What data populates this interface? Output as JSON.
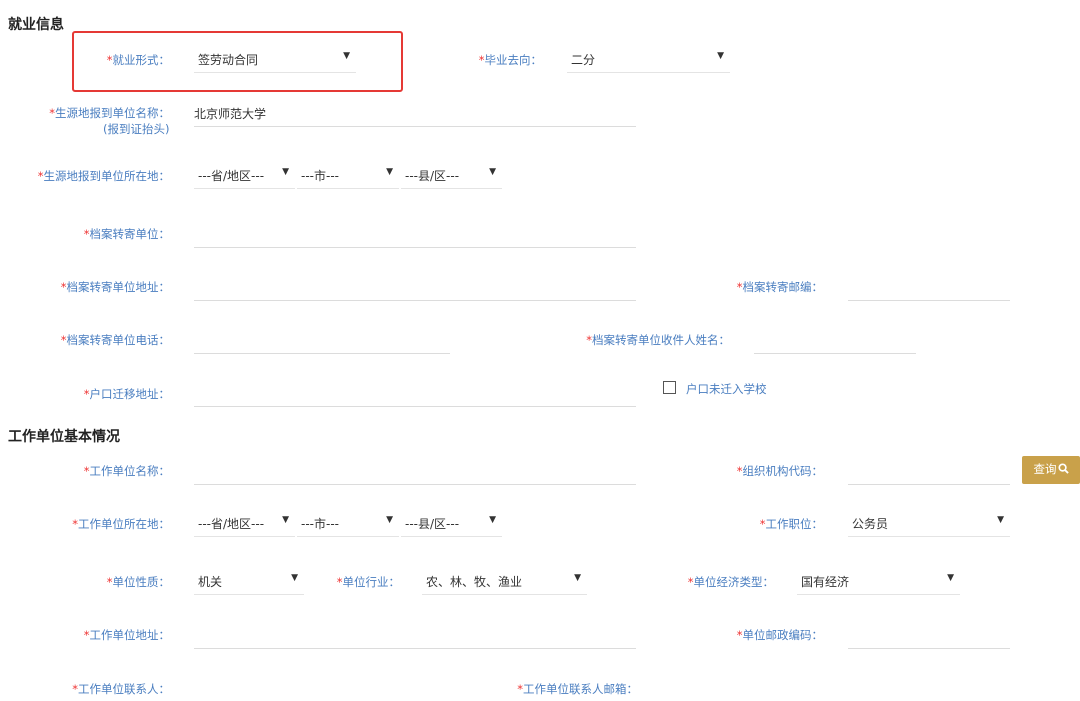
{
  "employment_info": {
    "title": "就业信息",
    "employment_form": {
      "label": "就业形式：",
      "value": "签劳动合同"
    },
    "graduation_destination": {
      "label": "毕业去向：",
      "value": "二分"
    },
    "report_unit_name": {
      "label": "生源地报到单位名称：",
      "sub_label": "(报到证抬头)",
      "value": "北京师范大学"
    },
    "report_unit_location": {
      "label": "生源地报到单位所在地：",
      "province": "---省/地区---",
      "city": "---市---",
      "county": "---县/区---"
    },
    "archive_unit": {
      "label": "档案转寄单位："
    },
    "archive_unit_address": {
      "label": "档案转寄单位地址："
    },
    "archive_postcode": {
      "label": "档案转寄邮编："
    },
    "archive_phone": {
      "label": "档案转寄单位电话："
    },
    "archive_recipient": {
      "label": "档案转寄单位收件人姓名："
    },
    "hukou_address": {
      "label": "户口迁移地址："
    },
    "hukou_not_moved": {
      "label": "户口未迁入学校",
      "checked": false
    }
  },
  "work_unit": {
    "title": "工作单位基本情况",
    "unit_name": {
      "label": "工作单位名称："
    },
    "org_code": {
      "label": "组织机构代码："
    },
    "query_button": "查询",
    "unit_location": {
      "label": "工作单位所在地：",
      "province": "---省/地区---",
      "city": "---市---",
      "county": "---县/区---"
    },
    "job_position": {
      "label": "工作职位：",
      "value": "公务员"
    },
    "unit_nature": {
      "label": "单位性质：",
      "value": "机关"
    },
    "unit_industry": {
      "label": "单位行业：",
      "value": "农、林、牧、渔业"
    },
    "economic_type": {
      "label": "单位经济类型：",
      "value": "国有经济"
    },
    "unit_address": {
      "label": "工作单位地址："
    },
    "unit_postcode": {
      "label": "单位邮政编码："
    },
    "contact_person": {
      "label": "工作单位联系人："
    },
    "contact_email": {
      "label": "工作单位联系人邮箱："
    }
  },
  "required_mark": "*",
  "caret": "▼",
  "colors": {
    "label": "#4a7ec0",
    "required": "#e33333",
    "button": "#c9a14a",
    "highlight": "#e53935"
  }
}
